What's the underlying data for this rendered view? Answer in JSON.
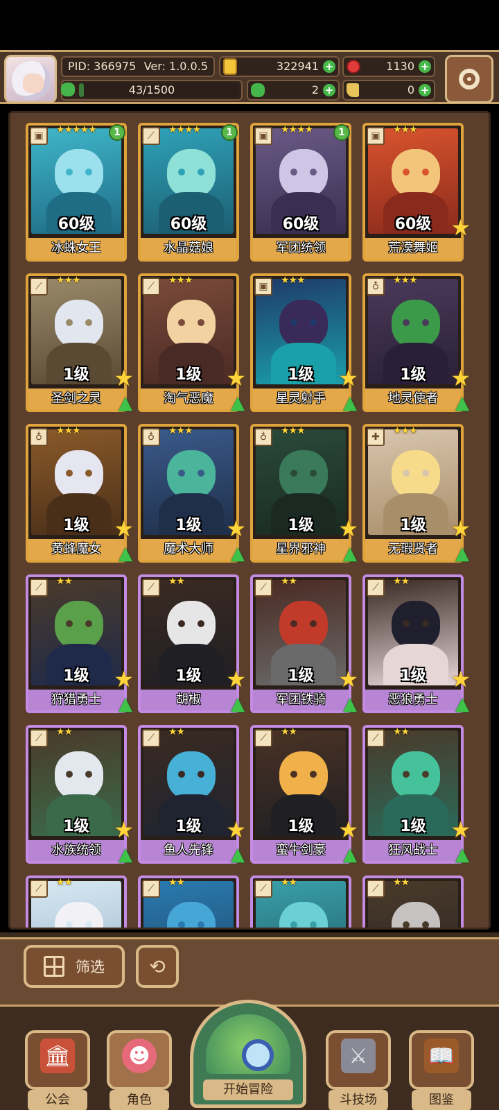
{
  "header": {
    "pid": "PID: 366975",
    "version": "Ver: 1.0.0.5",
    "gold": "322941",
    "gems": "1130",
    "progress_text": "43/1500",
    "progress_fraction": 0.0287,
    "clover": "2",
    "boot": "0",
    "colors": {
      "gold": "#f1c43a",
      "gem": "#e23b3b",
      "green": "#46b84a"
    }
  },
  "cards": [
    {
      "name": "冰蛛女王",
      "level": "60级",
      "stars": "★★★★★",
      "badge": "1",
      "type_icon": "book",
      "rarity": "gold",
      "palette": [
        "#3fb6c9",
        "#9be0ec",
        "#1f6c85"
      ],
      "has_star": false,
      "has_arrow": false
    },
    {
      "name": "水晶菇娘",
      "level": "60级",
      "stars": "★★★★",
      "badge": "1",
      "type_icon": "sword",
      "rarity": "gold",
      "palette": [
        "#2fa2b8",
        "#8fe0d6",
        "#1c5e72"
      ],
      "has_star": false,
      "has_arrow": false
    },
    {
      "name": "军团统领",
      "level": "60级",
      "stars": "★★★★",
      "badge": "1",
      "type_icon": "book",
      "rarity": "gold",
      "palette": [
        "#6a5a86",
        "#cfc6e6",
        "#3a2f52"
      ],
      "has_star": false,
      "has_arrow": false
    },
    {
      "name": "荒漠舞姬",
      "level": "60级",
      "stars": "★★★",
      "badge": "",
      "type_icon": "book",
      "rarity": "gold",
      "palette": [
        "#d9542e",
        "#f3c57a",
        "#8a2a1c"
      ],
      "has_star": true,
      "has_arrow": false
    },
    {
      "name": "圣剑之灵",
      "level": "1级",
      "stars": "★★★",
      "badge": "",
      "type_icon": "sword",
      "rarity": "gold",
      "palette": [
        "#9a8a6a",
        "#e2e6ee",
        "#5a4a34"
      ],
      "has_star": true,
      "has_arrow": true
    },
    {
      "name": "淘气恶魔",
      "level": "1级",
      "stars": "★★★",
      "badge": "",
      "type_icon": "sword",
      "rarity": "gold",
      "palette": [
        "#7a4a3a",
        "#f2d2a0",
        "#4a2a24"
      ],
      "has_star": true,
      "has_arrow": true
    },
    {
      "name": "星灵射手",
      "level": "1级",
      "stars": "★★★",
      "badge": "",
      "type_icon": "book",
      "rarity": "gold",
      "palette": [
        "#1f3a6a",
        "#3a2a5a",
        "#1aa0a8"
      ],
      "has_star": true,
      "has_arrow": true
    },
    {
      "name": "地灵使者",
      "level": "1级",
      "stars": "★★★",
      "badge": "",
      "type_icon": "staff",
      "rarity": "gold",
      "palette": [
        "#4a3a5a",
        "#3a9a4a",
        "#2a1f38"
      ],
      "has_star": true,
      "has_arrow": true
    },
    {
      "name": "黄蜂魔女",
      "level": "1级",
      "stars": "★★★",
      "badge": "",
      "type_icon": "staff",
      "rarity": "gold",
      "palette": [
        "#8a5a2a",
        "#e6e6f0",
        "#4a2f18"
      ],
      "has_star": true,
      "has_arrow": true
    },
    {
      "name": "魔术大师",
      "level": "1级",
      "stars": "★★★",
      "badge": "",
      "type_icon": "staff",
      "rarity": "gold",
      "palette": [
        "#3a5a8a",
        "#4ab59a",
        "#1f2f4a"
      ],
      "has_star": true,
      "has_arrow": true
    },
    {
      "name": "星界邪神",
      "level": "1级",
      "stars": "★★★",
      "badge": "",
      "type_icon": "staff",
      "rarity": "gold",
      "palette": [
        "#2a4a3a",
        "#3a7a5a",
        "#1a2a22"
      ],
      "has_star": true,
      "has_arrow": true
    },
    {
      "name": "无瑕贤者",
      "level": "1级",
      "stars": "★★★",
      "badge": "",
      "type_icon": "cross",
      "rarity": "gold",
      "palette": [
        "#d9c6ae",
        "#f6dc8a",
        "#a98e6a"
      ],
      "has_star": true,
      "has_arrow": true
    },
    {
      "name": "狩猎勇士",
      "level": "1级",
      "stars": "★★",
      "badge": "",
      "type_icon": "sword",
      "rarity": "purple",
      "palette": [
        "#4a3a2a",
        "#5aa04a",
        "#1f2a4a"
      ],
      "has_star": true,
      "has_arrow": true
    },
    {
      "name": "胡椒",
      "level": "1级",
      "stars": "★★",
      "badge": "",
      "type_icon": "sword",
      "rarity": "purple",
      "palette": [
        "#3a2a22",
        "#e6e6e6",
        "#1f1f24"
      ],
      "has_star": true,
      "has_arrow": true
    },
    {
      "name": "军团铁骑",
      "level": "1级",
      "stars": "★★",
      "badge": "",
      "type_icon": "sword",
      "rarity": "purple",
      "palette": [
        "#4a2a22",
        "#c23a2a",
        "#6a6a6a"
      ],
      "has_star": true,
      "has_arrow": true
    },
    {
      "name": "恶狼勇士",
      "level": "1级",
      "stars": "★★",
      "badge": "",
      "type_icon": "sword",
      "rarity": "purple",
      "palette": [
        "#3a2a24",
        "#1f1f2e",
        "#e6d6d6"
      ],
      "has_star": true,
      "has_arrow": true
    },
    {
      "name": "水族统领",
      "level": "1级",
      "stars": "★★",
      "badge": "",
      "type_icon": "sword",
      "rarity": "purple",
      "palette": [
        "#4a3a2a",
        "#e2e8ee",
        "#3a6a4a"
      ],
      "has_star": true,
      "has_arrow": true
    },
    {
      "name": "鱼人先锋",
      "level": "1级",
      "stars": "★★",
      "badge": "",
      "type_icon": "sword",
      "rarity": "purple",
      "palette": [
        "#3a2a22",
        "#46b0d6",
        "#1f2430"
      ],
      "has_star": true,
      "has_arrow": true
    },
    {
      "name": "蛮牛剑豪",
      "level": "1级",
      "stars": "★★",
      "badge": "",
      "type_icon": "sword",
      "rarity": "purple",
      "palette": [
        "#4a3224",
        "#f0b04a",
        "#1f1f24"
      ],
      "has_star": true,
      "has_arrow": true
    },
    {
      "name": "狂风战士",
      "level": "1级",
      "stars": "★★",
      "badge": "",
      "type_icon": "sword",
      "rarity": "purple",
      "palette": [
        "#4a3a2a",
        "#46c29a",
        "#2a6a5a"
      ],
      "has_star": true,
      "has_arrow": true
    },
    {
      "name": "",
      "level": "",
      "stars": "★★",
      "badge": "",
      "type_icon": "sword",
      "rarity": "purple",
      "palette": [
        "#d8e8f2",
        "#f2f2f6",
        "#9ab6cc"
      ],
      "has_star": false,
      "has_arrow": false
    },
    {
      "name": "",
      "level": "",
      "stars": "★★",
      "badge": "",
      "type_icon": "sword",
      "rarity": "purple",
      "palette": [
        "#2a7ab0",
        "#46a6d6",
        "#1f4a6a"
      ],
      "has_star": false,
      "has_arrow": false
    },
    {
      "name": "",
      "level": "",
      "stars": "★★",
      "badge": "",
      "type_icon": "sword",
      "rarity": "purple",
      "palette": [
        "#3aa0a8",
        "#6ad0d6",
        "#1f5a6a"
      ],
      "has_star": false,
      "has_arrow": false
    },
    {
      "name": "",
      "level": "",
      "stars": "★★",
      "badge": "",
      "type_icon": "sword",
      "rarity": "purple",
      "palette": [
        "#4a3a2a",
        "#c6c2c2",
        "#2a2424"
      ],
      "has_star": false,
      "has_arrow": false
    }
  ],
  "controls": {
    "filter_label": "筛选",
    "refresh_icon": "refresh-icon",
    "filter_icon": "grid-icon"
  },
  "nav": {
    "guild": "公会",
    "roles": "角色",
    "adventure": "开始冒险",
    "arena": "斗技场",
    "codex": "图鉴"
  }
}
